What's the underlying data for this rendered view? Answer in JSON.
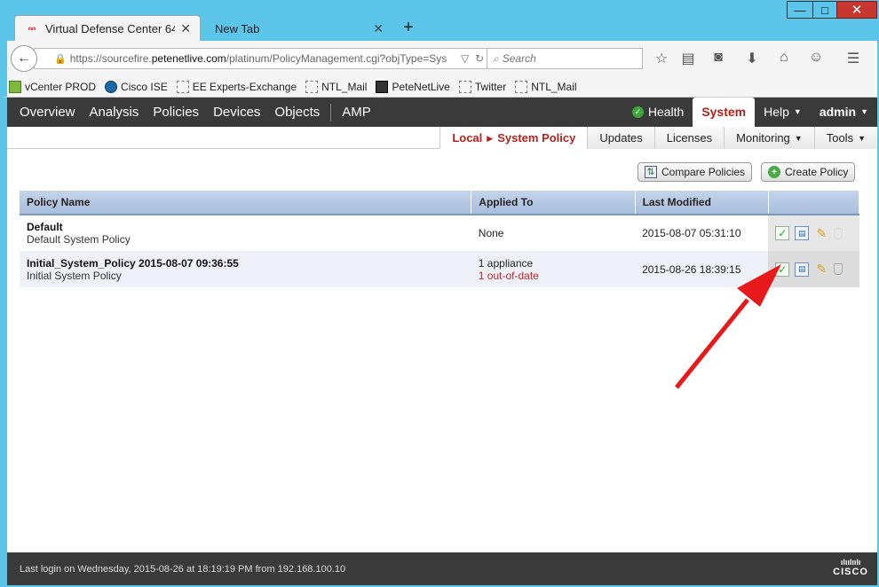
{
  "browser": {
    "tabs": [
      {
        "title": "Virtual Defense Center 64b...",
        "active": true
      },
      {
        "title": "New Tab",
        "active": false
      }
    ],
    "window_controls": {
      "minimize": "—",
      "maximize": "□",
      "close": "✕"
    },
    "url": {
      "prefix": "https://sourcefire.",
      "host": "petenetlive.com",
      "path": "/platinum/PolicyManagement.cgi?objType=Sys"
    },
    "search_placeholder": "Search",
    "bookmarks": [
      "vCenter PROD",
      "Cisco ISE",
      "EE Experts-Exchange",
      "NTL_Mail",
      "PeteNetLive",
      "Twitter",
      "NTL_Mail"
    ]
  },
  "app": {
    "main_nav": [
      "Overview",
      "Analysis",
      "Policies",
      "Devices",
      "Objects",
      "AMP"
    ],
    "right_nav": {
      "health": "Health",
      "system": "System",
      "help": "Help",
      "user": "admin"
    },
    "sub_nav": {
      "active_parent": "Local",
      "active_child": "System Policy",
      "items": [
        "Updates",
        "Licenses",
        "Monitoring",
        "Tools"
      ]
    },
    "buttons": {
      "compare": "Compare Policies",
      "create": "Create Policy"
    },
    "table": {
      "headers": [
        "Policy Name",
        "Applied To",
        "Last Modified"
      ],
      "rows": [
        {
          "name": "Default",
          "description": "Default System Policy",
          "applied": "None",
          "applied_warning": "",
          "modified": "2015-08-07 05:31:10"
        },
        {
          "name": "Initial_System_Policy 2015-08-07 09:36:55",
          "description": "Initial System Policy",
          "applied": "1 appliance",
          "applied_warning": "1 out-of-date",
          "modified": "2015-08-26 18:39:15"
        }
      ]
    },
    "footer": {
      "last_login": "Last login on Wednesday, 2015-08-26 at 18:19:19 PM from 192.168.100.10",
      "logo": "CISCO"
    }
  }
}
